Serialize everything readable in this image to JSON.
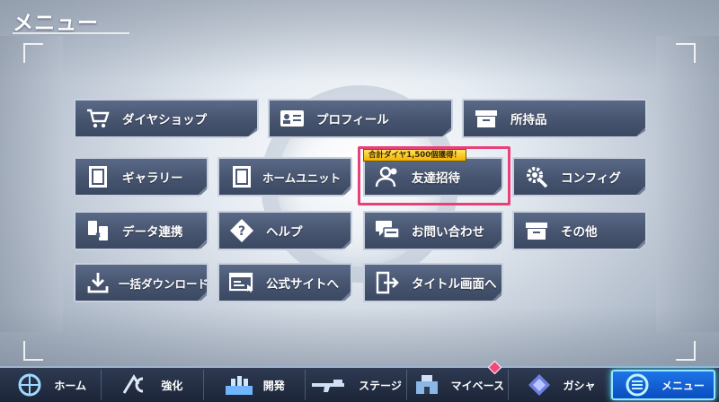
{
  "page": {
    "title": "メニュー"
  },
  "colors": {
    "button_bg": "#4b5a77",
    "button_border": "#c7d0dd",
    "highlight": "#ea3f79",
    "nav_active": "#1e74e8",
    "notif": "#ef4b7c"
  },
  "menu": {
    "promo_badge": "合計ダイヤ1,500個獲得！",
    "items": [
      {
        "label": "ダイヤショップ",
        "icon": "cart-icon"
      },
      {
        "label": "プロフィール",
        "icon": "id-card-icon"
      },
      {
        "label": "所持品",
        "icon": "box-icon"
      },
      {
        "label": "ギャラリー",
        "icon": "gallery-icon"
      },
      {
        "label": "ホームユニット",
        "icon": "home-unit-icon"
      },
      {
        "label": "友達招待",
        "icon": "friends-icon"
      },
      {
        "label": "コンフィグ",
        "icon": "gear-wrench-icon"
      },
      {
        "label": "データ連携",
        "icon": "data-link-icon"
      },
      {
        "label": "ヘルプ",
        "icon": "help-icon"
      },
      {
        "label": "お問い合わせ",
        "icon": "chat-icon"
      },
      {
        "label": "その他",
        "icon": "box-icon"
      },
      {
        "label": "一括ダウンロード",
        "icon": "download-icon"
      },
      {
        "label": "公式サイトへ",
        "icon": "website-icon"
      },
      {
        "label": "タイトル画面へ",
        "icon": "exit-door-icon"
      }
    ]
  },
  "nav": {
    "items": [
      {
        "label": "ホーム",
        "icon": "home-emblem-icon"
      },
      {
        "label": "強化",
        "icon": "upgrade-icon"
      },
      {
        "label": "開発",
        "icon": "develop-icon"
      },
      {
        "label": "ステージ",
        "icon": "stage-gun-icon"
      },
      {
        "label": "マイベース",
        "icon": "mybase-icon"
      },
      {
        "label": "ガシャ",
        "icon": "gacha-icon"
      },
      {
        "label": "メニュー",
        "icon": "menu-orb-icon"
      }
    ],
    "active": "メニュー"
  }
}
